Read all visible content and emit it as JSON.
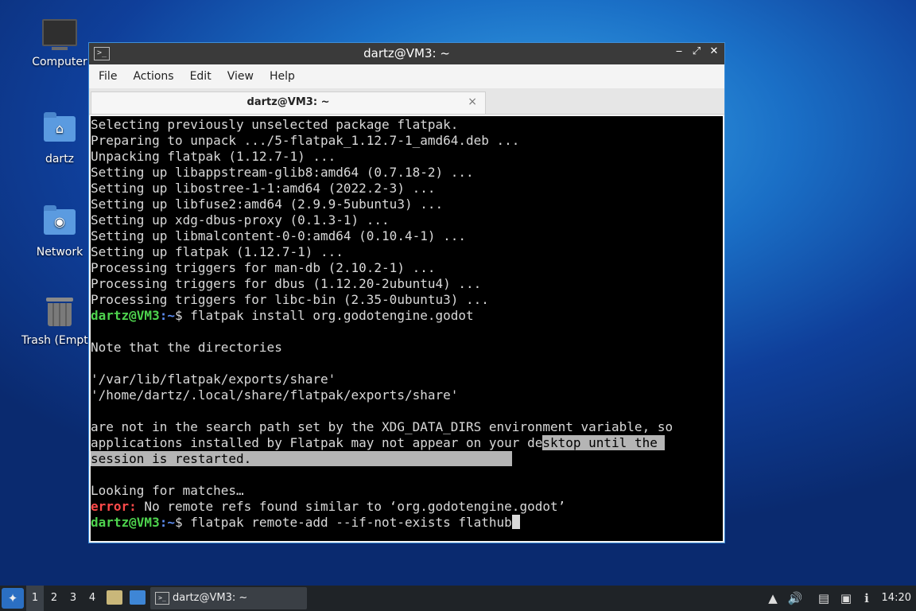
{
  "desktop": {
    "icons": [
      {
        "label": "Computer"
      },
      {
        "label": "dartz"
      },
      {
        "label": "Network"
      },
      {
        "label": "Trash (Empty)"
      }
    ]
  },
  "window": {
    "title": "dartz@VM3: ~",
    "menu": [
      "File",
      "Actions",
      "Edit",
      "View",
      "Help"
    ],
    "tab_label": "dartz@VM3: ~",
    "tab_close": "×"
  },
  "terminal": {
    "lines": [
      "Selecting previously unselected package flatpak.",
      "Preparing to unpack .../5-flatpak_1.12.7-1_amd64.deb ...",
      "Unpacking flatpak (1.12.7-1) ...",
      "Setting up libappstream-glib8:amd64 (0.7.18-2) ...",
      "Setting up libostree-1-1:amd64 (2022.2-3) ...",
      "Setting up libfuse2:amd64 (2.9.9-5ubuntu3) ...",
      "Setting up xdg-dbus-proxy (0.1.3-1) ...",
      "Setting up libmalcontent-0-0:amd64 (0.10.4-1) ...",
      "Setting up flatpak (1.12.7-1) ...",
      "Processing triggers for man-db (2.10.2-1) ...",
      "Processing triggers for dbus (1.12.20-2ubuntu4) ...",
      "Processing triggers for libc-bin (2.35-0ubuntu3) ..."
    ],
    "prompt_user": "dartz@VM3",
    "prompt_path": ":~",
    "prompt_sym": "$ ",
    "cmd1": "flatpak install org.godotengine.godot",
    "note": "Note that the directories",
    "dir1": "'/var/lib/flatpak/exports/share'",
    "dir2": "'/home/dartz/.local/share/flatpak/exports/share'",
    "warn1": "are not in the search path set by the XDG_DATA_DIRS environment variable, so",
    "warn2a": "applications installed by Flatpak may not appear on your de",
    "warn2b": "sktop until the ",
    "warn3": "session is restarted.                                  ",
    "looking": "Looking for matches…",
    "error_label": "error:",
    "error_text": " No remote refs found similar to ‘org.godotengine.godot’",
    "cmd2": "flatpak remote-add --if-not-exists flathub"
  },
  "taskbar": {
    "workspaces": [
      "1",
      "2",
      "3",
      "4"
    ],
    "active_task": "dartz@VM3: ~",
    "clock": "14:20"
  }
}
